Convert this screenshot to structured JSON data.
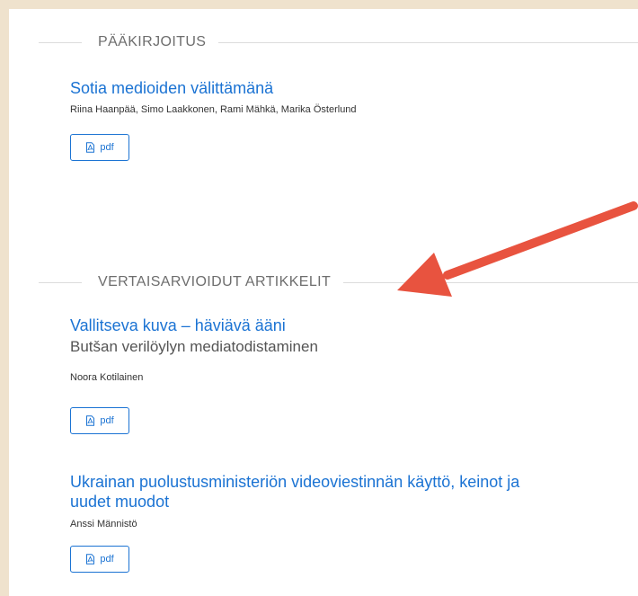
{
  "sections": [
    {
      "heading": "PÄÄKIRJOITUS",
      "articles": [
        {
          "title": "Sotia medioiden välittämänä",
          "authors": "Riina Haanpää, Simo Laakkonen, Rami Mähkä, Marika Österlund",
          "galley_label": "pdf"
        }
      ]
    },
    {
      "heading": "VERTAISARVIOIDUT ARTIKKELIT",
      "articles": [
        {
          "title": "Vallitseva kuva – häviävä ääni",
          "subtitle": "Butšan verilöylyn mediatodistaminen",
          "authors": "Noora Kotilainen",
          "galley_label": "pdf"
        },
        {
          "title_line1": "Ukrainan puolustusministeriön videoviestinnän käyttö, keinot ja",
          "title_line2": "uudet muodot",
          "authors": "Anssi Männistö",
          "galley_label": "pdf"
        }
      ]
    }
  ],
  "icons": {
    "galley": "pdf-file-icon",
    "annotation": "red-arrow"
  },
  "colors": {
    "background": "#efe2cd",
    "link": "#1b73d3",
    "annotation_arrow": "#e8533f"
  }
}
